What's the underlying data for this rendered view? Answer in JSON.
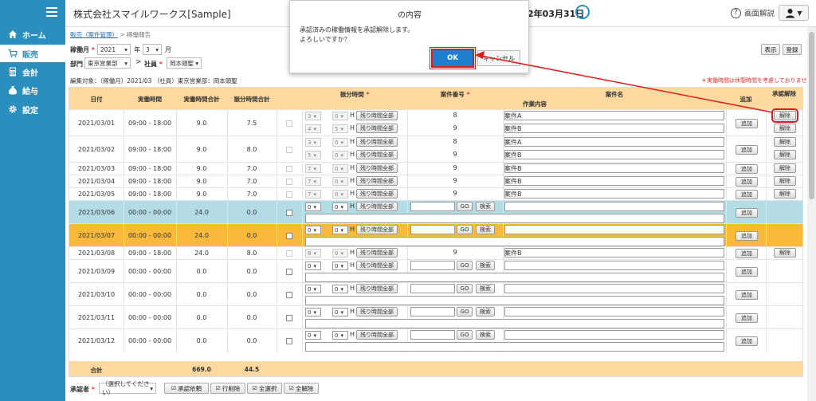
{
  "sidebar": {
    "items": [
      {
        "label": "ホーム",
        "icon": "home-icon"
      },
      {
        "label": "販売",
        "icon": "cart-icon"
      },
      {
        "label": "会計",
        "icon": "calculator-icon"
      },
      {
        "label": "給与",
        "icon": "money-bag-icon"
      },
      {
        "label": "設定",
        "icon": "gear-icon"
      }
    ]
  },
  "header": {
    "company": "株式会社スマイルワークス[Sample]",
    "date": "2年03月31日",
    "help_label": "画面解説",
    "user_caret": "▼"
  },
  "breadcrumb": {
    "link": "販売（案件管理）",
    "sep": ">",
    "current": "稼働報告"
  },
  "filters": {
    "month_label": "稼働月",
    "year": "2021",
    "year_unit": "年",
    "month": "3",
    "month_unit": "月",
    "dept_label": "部門",
    "dept": "東京営業部",
    "arrow": ">",
    "emp_label": "社員",
    "emp": "岡本頭聖",
    "req": "*"
  },
  "actions": {
    "display": "表示",
    "register": "登録"
  },
  "edit_target": "編集対象：（稼働月）2021/03 （社員）東京営業部：岡本頭聖",
  "note": "＊実働時間は休憩時間を考慮しておりません",
  "table": {
    "headers": {
      "date": "日付",
      "work_time": "実働時間",
      "work_total": "実働時間合計",
      "alloc_total": "振分時間合計",
      "alloc_time": "振分時間",
      "case_no": "案件番号",
      "case_name": "案件名",
      "work_content": "作業内容",
      "add": "追加",
      "approve": "承認解除"
    },
    "labels": {
      "remaining": "残り時間全部",
      "h": "H",
      "go": "GO",
      "search": "検索",
      "add": "追加",
      "release": "解除",
      "caret": "▾"
    },
    "rows": [
      {
        "date": "2021/03/01",
        "time": "09:00 - 18:00",
        "total": "9.0",
        "alloc": "7.5",
        "locked": true,
        "subs": [
          {
            "h": "3",
            "m": "0",
            "no": "8",
            "name": "案件A"
          },
          {
            "h": "4",
            "m": "5",
            "no": "9",
            "name": "案件B"
          }
        ]
      },
      {
        "date": "2021/03/02",
        "time": "09:00 - 18:00",
        "total": "9.0",
        "alloc": "8.0",
        "locked": true,
        "subs": [
          {
            "h": "3",
            "m": "0",
            "no": "8",
            "name": "案件A"
          },
          {
            "h": "5",
            "m": "0",
            "no": "9",
            "name": "案件B"
          }
        ]
      },
      {
        "date": "2021/03/03",
        "time": "09:00 - 18:00",
        "total": "9.0",
        "alloc": "7.0",
        "locked": true,
        "subs": [
          {
            "h": "7",
            "m": "0",
            "no": "9",
            "name": "案件B"
          }
        ]
      },
      {
        "date": "2021/03/04",
        "time": "09:00 - 18:00",
        "total": "9.0",
        "alloc": "7.0",
        "locked": true,
        "subs": [
          {
            "h": "7",
            "m": "0",
            "no": "9",
            "name": "案件B"
          }
        ]
      },
      {
        "date": "2021/03/05",
        "time": "09:00 - 18:00",
        "total": "9.0",
        "alloc": "7.0",
        "locked": true,
        "subs": [
          {
            "h": "7",
            "m": "0",
            "no": "9",
            "name": "案件B"
          }
        ]
      },
      {
        "date": "2021/03/06",
        "time": "00:00 - 00:00",
        "total": "24.0",
        "alloc": "0.0",
        "locked": false,
        "style": "blue",
        "subs": [
          {
            "h": "0",
            "m": "0",
            "no": "",
            "name": ""
          }
        ]
      },
      {
        "date": "2021/03/07",
        "time": "00:00 - 00:00",
        "total": "24.0",
        "alloc": "0.0",
        "locked": false,
        "style": "orange",
        "subs": [
          {
            "h": "0",
            "m": "0",
            "no": "",
            "name": ""
          }
        ]
      },
      {
        "date": "2021/03/08",
        "time": "09:00 - 18:00",
        "total": "24.0",
        "alloc": "8.0",
        "locked": true,
        "subs": [
          {
            "h": "8",
            "m": "0",
            "no": "9",
            "name": "案件B"
          }
        ]
      },
      {
        "date": "2021/03/09",
        "time": "00:00 - 00:00",
        "total": "0.0",
        "alloc": "0.0",
        "locked": false,
        "subs": [
          {
            "h": "0",
            "m": "0",
            "no": "",
            "name": ""
          }
        ]
      },
      {
        "date": "2021/03/10",
        "time": "00:00 - 00:00",
        "total": "0.0",
        "alloc": "0.0",
        "locked": false,
        "subs": [
          {
            "h": "0",
            "m": "0",
            "no": "",
            "name": ""
          }
        ]
      },
      {
        "date": "2021/03/11",
        "time": "00:00 - 00:00",
        "total": "0.0",
        "alloc": "0.0",
        "locked": false,
        "subs": [
          {
            "h": "0",
            "m": "0",
            "no": "",
            "name": ""
          }
        ]
      },
      {
        "date": "2021/03/12",
        "time": "00:00 - 00:00",
        "total": "0.0",
        "alloc": "0.0",
        "locked": false,
        "subs": [
          {
            "h": "0",
            "m": "0",
            "no": "",
            "name": ""
          }
        ]
      }
    ],
    "footer": {
      "label": "合計",
      "work_total": "669.0",
      "alloc_total": "44.5"
    }
  },
  "bottom": {
    "approver_label": "承認者",
    "approver_select": "（選択してください）",
    "buttons": [
      "承認依頼",
      "行削除",
      "全選択",
      "全解除"
    ]
  },
  "dialog": {
    "title": "の内容",
    "message1": "承認済みの稼働情報を承認解除します。",
    "message2": "よろしいですか？",
    "ok": "OK",
    "cancel": "キャンセル"
  },
  "colors": {
    "primary": "#2b8fbe",
    "header_row": "#fdd9a0",
    "row_blue": "#b4dce6",
    "row_orange": "#f9b93a",
    "highlight": "#e01b1b",
    "ok_button": "#1e7fd1"
  }
}
